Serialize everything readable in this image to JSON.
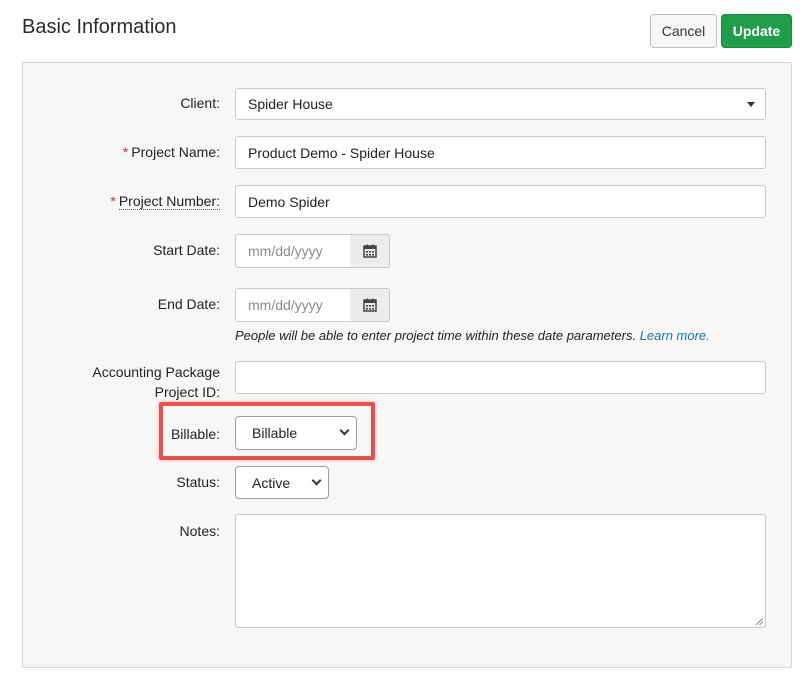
{
  "header": {
    "title": "Basic Information",
    "cancel_label": "Cancel",
    "update_label": "Update"
  },
  "form": {
    "client": {
      "label": "Client:",
      "value": "Spider House"
    },
    "project_name": {
      "required_mark": "*",
      "label": "Project Name:",
      "value": "Product Demo - Spider House"
    },
    "project_number": {
      "required_mark": "*",
      "label": "Project Number:",
      "value": "Demo Spider"
    },
    "start_date": {
      "label": "Start Date:",
      "placeholder": "mm/dd/yyyy"
    },
    "end_date": {
      "label": "End Date:",
      "placeholder": "mm/dd/yyyy"
    },
    "date_hint": {
      "text": "People will be able to enter project time within these date parameters.",
      "link": "Learn more."
    },
    "accounting_id": {
      "label_line1": "Accounting Package",
      "label_line2": "Project ID:",
      "value": ""
    },
    "billable": {
      "label": "Billable:",
      "value": "Billable"
    },
    "status": {
      "label": "Status:",
      "value": "Active"
    },
    "notes": {
      "label": "Notes:",
      "value": ""
    }
  },
  "colors": {
    "update_button": "#1f9d4a",
    "required_asterisk": "#d8262b",
    "link": "#1a73b5",
    "highlight_box": "#e5534b"
  },
  "icons": {
    "calendar": "calendar-icon",
    "dropdown": "caret-down-icon",
    "select_chevron": "chevron-down-icon"
  }
}
